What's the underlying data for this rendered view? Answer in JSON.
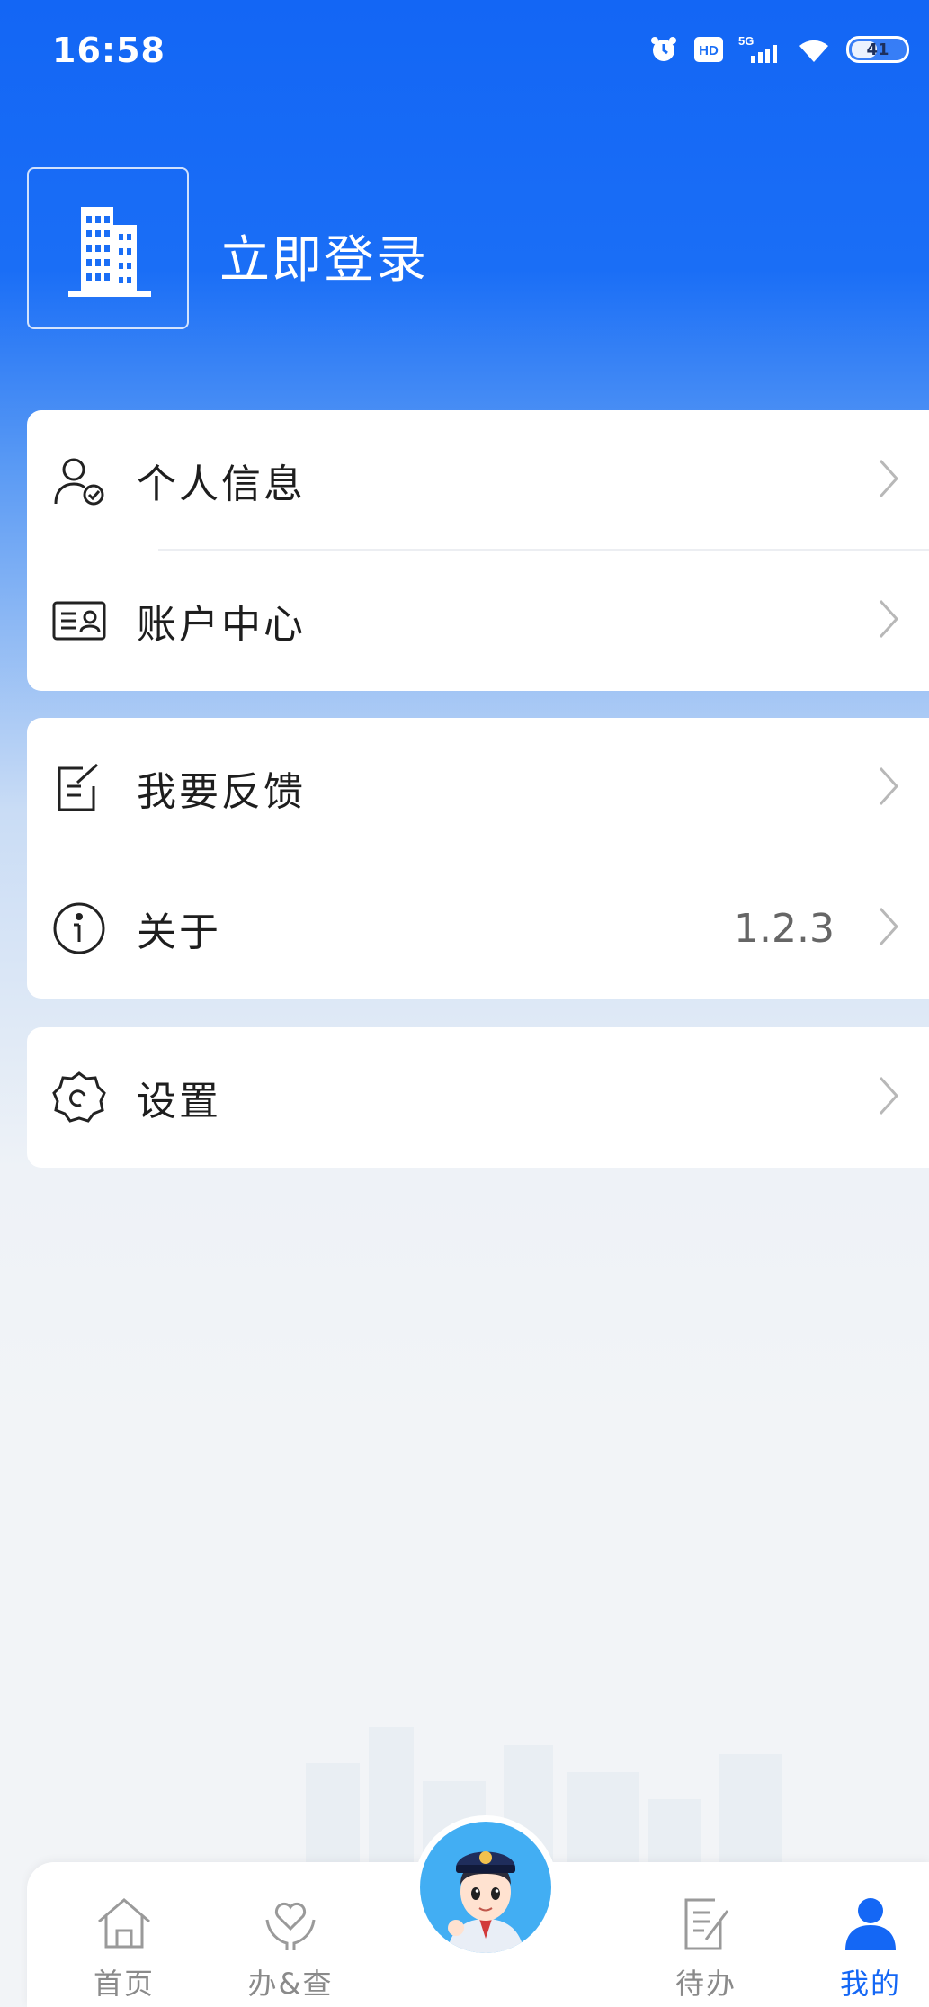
{
  "status_bar": {
    "time": "16:58",
    "signal_label": "5G",
    "hd_label": "HD",
    "battery": "41"
  },
  "profile": {
    "login_text": "立即登录",
    "avatar_icon": "building-icon"
  },
  "menu": {
    "group1": [
      {
        "label": "个人信息",
        "icon": "user-check-icon"
      },
      {
        "label": "账户中心",
        "icon": "id-card-icon"
      }
    ],
    "group2": [
      {
        "label": "我要反馈",
        "icon": "edit-note-icon"
      },
      {
        "label": "关于",
        "icon": "info-icon",
        "value": "1.2.3"
      }
    ],
    "group3": [
      {
        "label": "设置",
        "icon": "gear-icon"
      }
    ]
  },
  "bottom_nav": {
    "items": [
      {
        "label": "首页",
        "icon": "home-icon"
      },
      {
        "label": "办&查",
        "icon": "heart-hands-icon"
      },
      {
        "label": "待办",
        "icon": "todo-icon"
      },
      {
        "label": "我的",
        "icon": "person-icon"
      }
    ],
    "center_icon": "mascot-officer-icon"
  },
  "colors": {
    "primary": "#1467f5",
    "inactive": "#8a8a8a",
    "text": "#1e1e1e"
  }
}
